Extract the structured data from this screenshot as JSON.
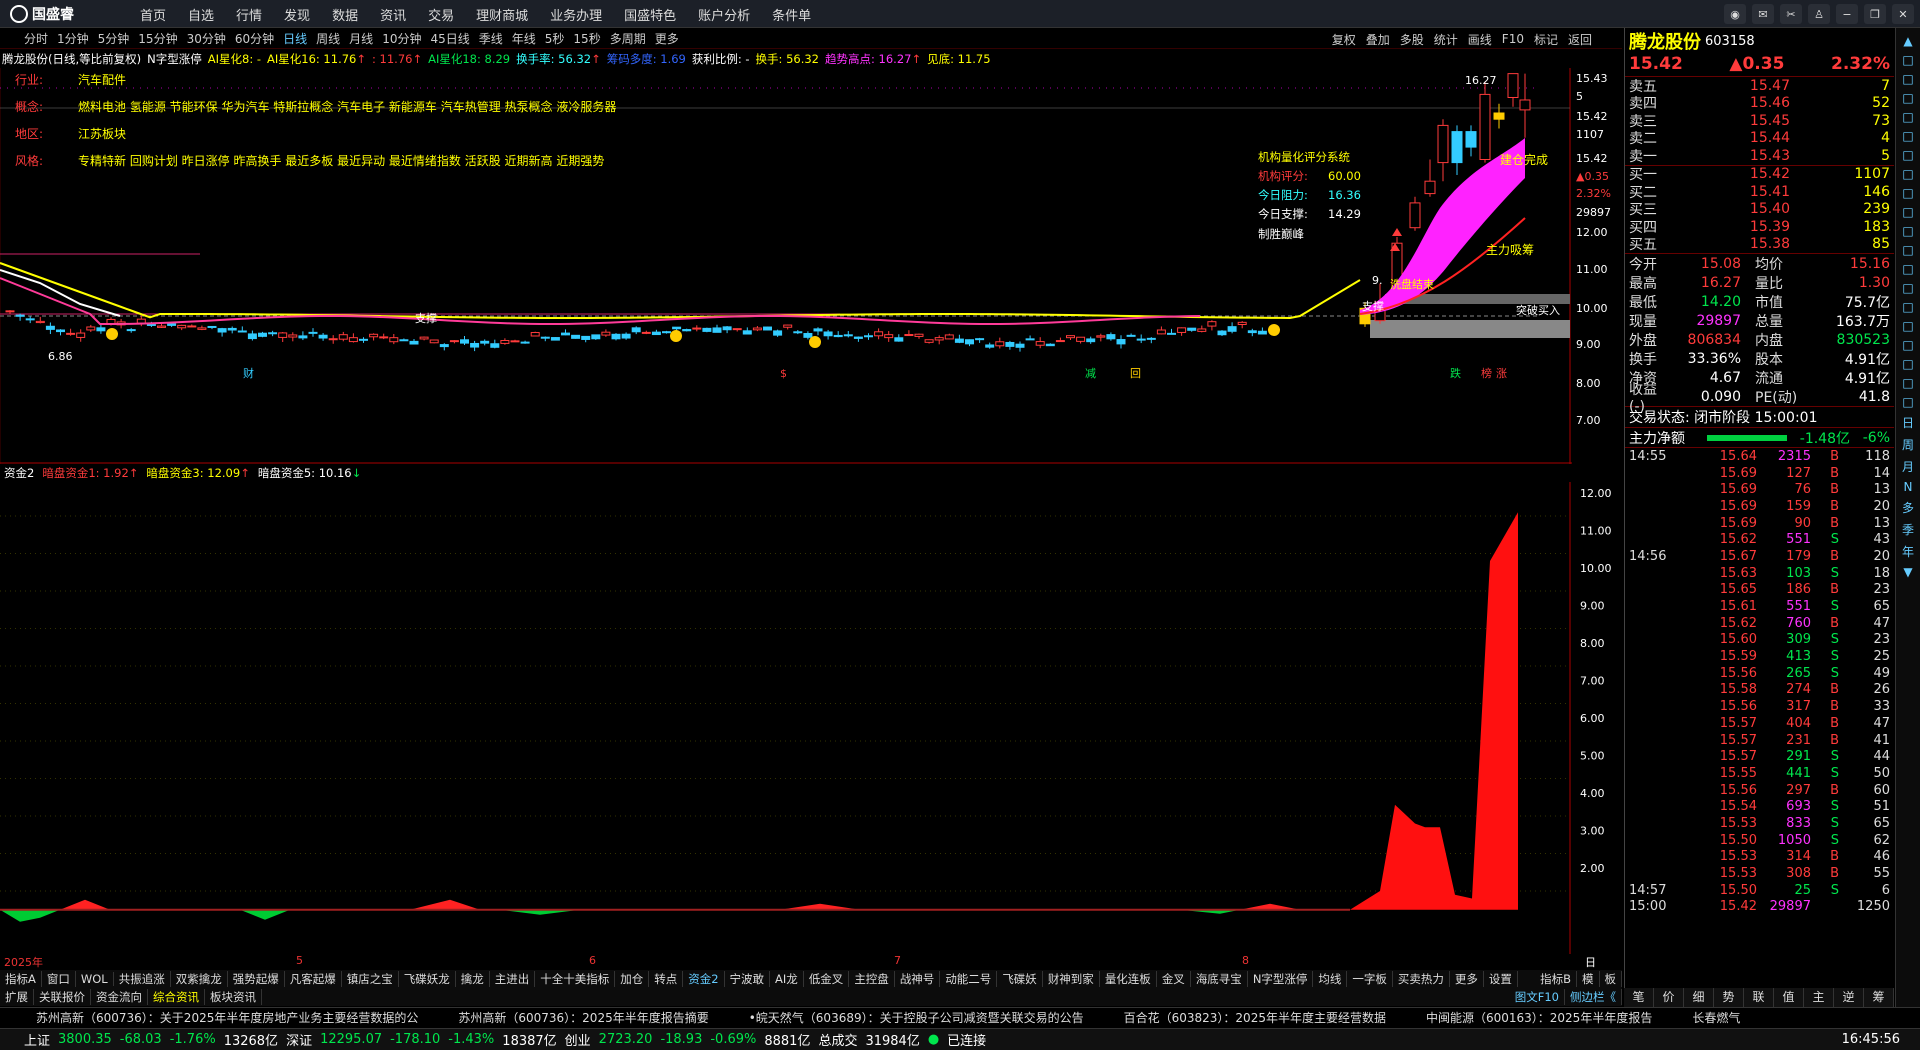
{
  "app": {
    "logo": "国盛睿",
    "menu": [
      "首页",
      "自选",
      "行情",
      "发现",
      "数据",
      "资讯",
      "交易",
      "理财商城",
      "业务办理",
      "国盛特色",
      "账户分析",
      "条件单"
    ]
  },
  "window_buttons": [
    "chat-icon",
    "email-icon",
    "scissors-icon",
    "tshirt-icon",
    "minus-icon",
    "restore-icon",
    "close-icon"
  ],
  "periods": [
    "分时",
    "1分钟",
    "5分钟",
    "15分钟",
    "30分钟",
    "60分钟",
    "日线",
    "周线",
    "月线",
    "10分钟",
    "45日线",
    "季线",
    "年线",
    "5秒",
    "15秒",
    "多周期",
    "更多"
  ],
  "period_active": "日线",
  "tools": [
    "复权",
    "叠加",
    "多股",
    "统计",
    "画线",
    "F10",
    "标记",
    "返回"
  ],
  "info": {
    "name": "腾龙股份(日线,等比前复权)",
    "ind": "N字型涨停",
    "a1": "AI星化8: -",
    "a2": "AI星化16: 11.76",
    "a2b": "↑",
    "a3": ": 11.76",
    "a3b": "↑",
    "a4": "AI星化18: 8.29",
    "a5": "换手率: 56.32",
    "a5b": "↑",
    "a6": "筹码多度: 1.69",
    "a7": "获利比例: -",
    "a8": "换手: 56.32",
    "a9": "趋势高点: 16.27",
    "a9b": "↑",
    "a10": "见底: 11.75"
  },
  "tags": [
    {
      "k": "行业:",
      "v": "汽车配件"
    },
    {
      "k": "概念:",
      "v": "燃料电池 氢能源 节能环保 华为汽车 特斯拉概念 汽车电子 新能源车 汽车热管理 热泵概念 液冷服务器"
    },
    {
      "k": "地区:",
      "v": "江苏板块"
    },
    {
      "k": "风格:",
      "v": "专精特新 回购计划 昨日涨停 昨高换手 最近多板 最近异动 最近情绪指数 活跃股 近期新高 近期强势"
    }
  ],
  "score": {
    "title": "机构量化评分系统",
    "l1": "机构评分:",
    "v1": "60.00",
    "l2": "今日阻力:",
    "v2": "16.36",
    "l3": "今日支撑:",
    "v3": "14.29",
    "foot": "制胜巅峰"
  },
  "labels": {
    "hi": "16.27",
    "lo": "6.86",
    "jian": "建仓完成",
    "zhuli": "主力吸筹",
    "xipan": "洗盘结束",
    "zc1": "支撑",
    "zc2": "支撑",
    "tupo": "突破买入",
    "nine": "9.",
    "cai": "财",
    "jian2": "减",
    "hui": "回",
    "die": "跌",
    "bang": "榜",
    "zhang": "涨",
    "s": "$"
  },
  "main_axis": [
    "15.43",
    "5",
    "15.42",
    "1107",
    "15.42",
    "▲0.35",
    "2.32%",
    "29897",
    "12.00",
    "11.00",
    "10.00",
    "9.00",
    "8.00",
    "7.00"
  ],
  "sub": {
    "name": "资金2",
    "a": "暗盘资金1: 1.92",
    "ab": "↑",
    "b": "暗盘资金3: 12.09",
    "bb": "↑",
    "c": "暗盘资金5: 10.16",
    "cb": "↓"
  },
  "sub_axis": [
    "12.00",
    "11.00",
    "10.00",
    "9.00",
    "8.00",
    "7.00",
    "6.00",
    "5.00",
    "4.00",
    "3.00",
    "2.00"
  ],
  "xaxis": [
    "2025年",
    "5",
    "6",
    "7",
    "8"
  ],
  "axis_label": "日线",
  "tabs1": [
    "指标A",
    "窗口",
    "WOL",
    "共振追涨",
    "双紫擒龙",
    "强势起爆",
    "凡客起爆",
    "镇店之宝",
    "飞碟妖龙",
    "擒龙",
    "主进出",
    "十全十美指标",
    "加仓",
    "转点",
    "资金2",
    "宁波敢",
    "AI龙",
    "低金叉",
    "主控盘",
    "战神号",
    "动能二号",
    "飞碟妖",
    "财神到家",
    "量化连板",
    "金叉",
    "海底寻宝",
    "N字型涨停",
    "均线",
    "一字板",
    "买卖热力",
    "更多",
    "设置"
  ],
  "tabs1_right": [
    "指标B",
    "模",
    "板"
  ],
  "tabs2": [
    "扩展",
    "关联报价",
    "资金流向",
    "综合资讯",
    "板块资讯"
  ],
  "tabs2_right": [
    "图文F10",
    "侧边栏《"
  ],
  "news": [
    "苏州高新（600736）：关于2025年半年度房地产业务主要经营数据的公",
    "苏州高新（600736）：2025年半年度报告摘要",
    "•皖天然气（603689）：关于控股子公司减资暨关联交易的公告",
    "百合花（603823）：2025年半年度主要经营数据",
    "中闽能源（600163）：2025年半年度报告",
    "长春燃气"
  ],
  "status": {
    "sh": "上证",
    "shv": "3800.35",
    "shc": "-68.03",
    "shp": "-1.76%",
    "sha": "13268亿",
    "sz": "深证",
    "szv": "12295.07",
    "szc": "-178.10",
    "szp": "-1.43%",
    "sza": "18387亿",
    "cy": "创业",
    "cyv": "2723.20",
    "cyc": "-18.93",
    "cyp": "-0.69%",
    "cya": "8881亿",
    "tl": "总成交",
    "ta": "31984亿",
    "conn": "已连接",
    "time": "16:45:56"
  },
  "quote": {
    "name": "腾龙股份",
    "code": "603158",
    "price": "15.42",
    "chg": "▲0.35",
    "pct": "2.32%",
    "asks": [
      {
        "l": "卖五",
        "p": "15.47",
        "v": "7"
      },
      {
        "l": "卖四",
        "p": "15.46",
        "v": "52"
      },
      {
        "l": "卖三",
        "p": "15.45",
        "v": "73"
      },
      {
        "l": "卖二",
        "p": "15.44",
        "v": "4"
      },
      {
        "l": "卖一",
        "p": "15.43",
        "v": "5"
      }
    ],
    "bids": [
      {
        "l": "买一",
        "p": "15.42",
        "v": "1107"
      },
      {
        "l": "买二",
        "p": "15.41",
        "v": "146"
      },
      {
        "l": "买三",
        "p": "15.40",
        "v": "239"
      },
      {
        "l": "买四",
        "p": "15.39",
        "v": "183"
      },
      {
        "l": "买五",
        "p": "15.38",
        "v": "85"
      }
    ],
    "stats": [
      {
        "a": "今开",
        "b": "15.08",
        "bc": "red",
        "c": "均价",
        "d": "15.16",
        "dc": "red"
      },
      {
        "a": "最高",
        "b": "16.27",
        "bc": "red",
        "c": "量比",
        "d": "1.30",
        "dc": "red"
      },
      {
        "a": "最低",
        "b": "14.20",
        "bc": "green",
        "c": "市值",
        "d": "75.7亿",
        "dc": "white"
      },
      {
        "a": "现量",
        "b": "29897",
        "bc": "mag",
        "c": "总量",
        "d": "163.7万",
        "dc": "white"
      },
      {
        "a": "外盘",
        "b": "806834",
        "bc": "red",
        "c": "内盘",
        "d": "830523",
        "dc": "green"
      },
      {
        "a": "换手",
        "b": "33.36%",
        "bc": "white",
        "c": "股本",
        "d": "4.91亿",
        "dc": "white"
      },
      {
        "a": "净资",
        "b": "4.67",
        "bc": "white",
        "c": "流通",
        "d": "4.91亿",
        "dc": "white"
      },
      {
        "a": "收益(-)",
        "b": "0.090",
        "bc": "white",
        "c": "PE(动)",
        "d": "41.8",
        "dc": "white"
      }
    ],
    "state": "交易状态: 闭市阶段 15:00:01",
    "netflow_label": "主力净额",
    "netflow": "-1.48亿",
    "netflow_pct": "-6%",
    "ticks": [
      {
        "t": "14:55",
        "p": "15.64",
        "v": "2315",
        "s": "B",
        "n": "118",
        "vc": "mag"
      },
      {
        "t": "",
        "p": "15.69",
        "v": "127",
        "s": "B",
        "n": "14",
        "vc": "red"
      },
      {
        "t": "",
        "p": "15.69",
        "v": "76",
        "s": "B",
        "n": "13",
        "vc": "red"
      },
      {
        "t": "",
        "p": "15.69",
        "v": "159",
        "s": "B",
        "n": "20",
        "vc": "red"
      },
      {
        "t": "",
        "p": "15.69",
        "v": "90",
        "s": "B",
        "n": "13",
        "vc": "red"
      },
      {
        "t": "",
        "p": "15.62",
        "v": "551",
        "s": "S",
        "n": "43",
        "vc": "mag"
      },
      {
        "t": "14:56",
        "p": "15.67",
        "v": "179",
        "s": "B",
        "n": "20",
        "vc": "red"
      },
      {
        "t": "",
        "p": "15.63",
        "v": "103",
        "s": "S",
        "n": "18",
        "vc": "green"
      },
      {
        "t": "",
        "p": "15.65",
        "v": "186",
        "s": "B",
        "n": "23",
        "vc": "red"
      },
      {
        "t": "",
        "p": "15.61",
        "v": "551",
        "s": "S",
        "n": "65",
        "vc": "mag"
      },
      {
        "t": "",
        "p": "15.62",
        "v": "760",
        "s": "B",
        "n": "47",
        "vc": "mag"
      },
      {
        "t": "",
        "p": "15.60",
        "v": "309",
        "s": "S",
        "n": "23",
        "vc": "green"
      },
      {
        "t": "",
        "p": "15.59",
        "v": "413",
        "s": "S",
        "n": "25",
        "vc": "green"
      },
      {
        "t": "",
        "p": "15.56",
        "v": "265",
        "s": "S",
        "n": "49",
        "vc": "green"
      },
      {
        "t": "",
        "p": "15.58",
        "v": "274",
        "s": "B",
        "n": "26",
        "vc": "red"
      },
      {
        "t": "",
        "p": "15.56",
        "v": "317",
        "s": "B",
        "n": "33",
        "vc": "red"
      },
      {
        "t": "",
        "p": "15.57",
        "v": "404",
        "s": "B",
        "n": "47",
        "vc": "red"
      },
      {
        "t": "",
        "p": "15.57",
        "v": "231",
        "s": "B",
        "n": "41",
        "vc": "red"
      },
      {
        "t": "",
        "p": "15.57",
        "v": "291",
        "s": "S",
        "n": "44",
        "vc": "green"
      },
      {
        "t": "",
        "p": "15.55",
        "v": "441",
        "s": "S",
        "n": "50",
        "vc": "green"
      },
      {
        "t": "",
        "p": "15.56",
        "v": "297",
        "s": "B",
        "n": "60",
        "vc": "red"
      },
      {
        "t": "",
        "p": "15.54",
        "v": "693",
        "s": "S",
        "n": "51",
        "vc": "mag"
      },
      {
        "t": "",
        "p": "15.53",
        "v": "833",
        "s": "S",
        "n": "65",
        "vc": "mag"
      },
      {
        "t": "",
        "p": "15.50",
        "v": "1050",
        "s": "S",
        "n": "62",
        "vc": "mag"
      },
      {
        "t": "",
        "p": "15.53",
        "v": "314",
        "s": "B",
        "n": "46",
        "vc": "red"
      },
      {
        "t": "",
        "p": "15.53",
        "v": "308",
        "s": "B",
        "n": "55",
        "vc": "red"
      },
      {
        "t": "14:57",
        "p": "15.50",
        "v": "25",
        "s": "S",
        "n": "6",
        "vc": "green"
      },
      {
        "t": "15:00",
        "p": "15.42",
        "v": "29897",
        "s": "",
        "n": "1250",
        "vc": "mag"
      }
    ],
    "tabs": [
      "笔",
      "价",
      "细",
      "势",
      "联",
      "值",
      "主",
      "逆",
      "筹"
    ]
  },
  "sidebar": [
    "▲",
    "□",
    "□",
    "□",
    "□",
    "□",
    "□",
    "□",
    "□",
    "□",
    "□",
    "□",
    "□",
    "□",
    "□",
    "□",
    "□",
    "□",
    "□",
    "□",
    "日",
    "周",
    "月",
    "N",
    "多",
    "季",
    "年",
    "▼"
  ],
  "chart_data": {
    "type": "line",
    "series": [
      {
        "name": "暗盘资金1",
        "values": [
          1.92
        ]
      },
      {
        "name": "暗盘资金3",
        "values": [
          12.09
        ]
      },
      {
        "name": "暗盘资金5",
        "values": [
          10.16
        ]
      }
    ],
    "ylim": [
      1.5,
      12.5
    ]
  }
}
